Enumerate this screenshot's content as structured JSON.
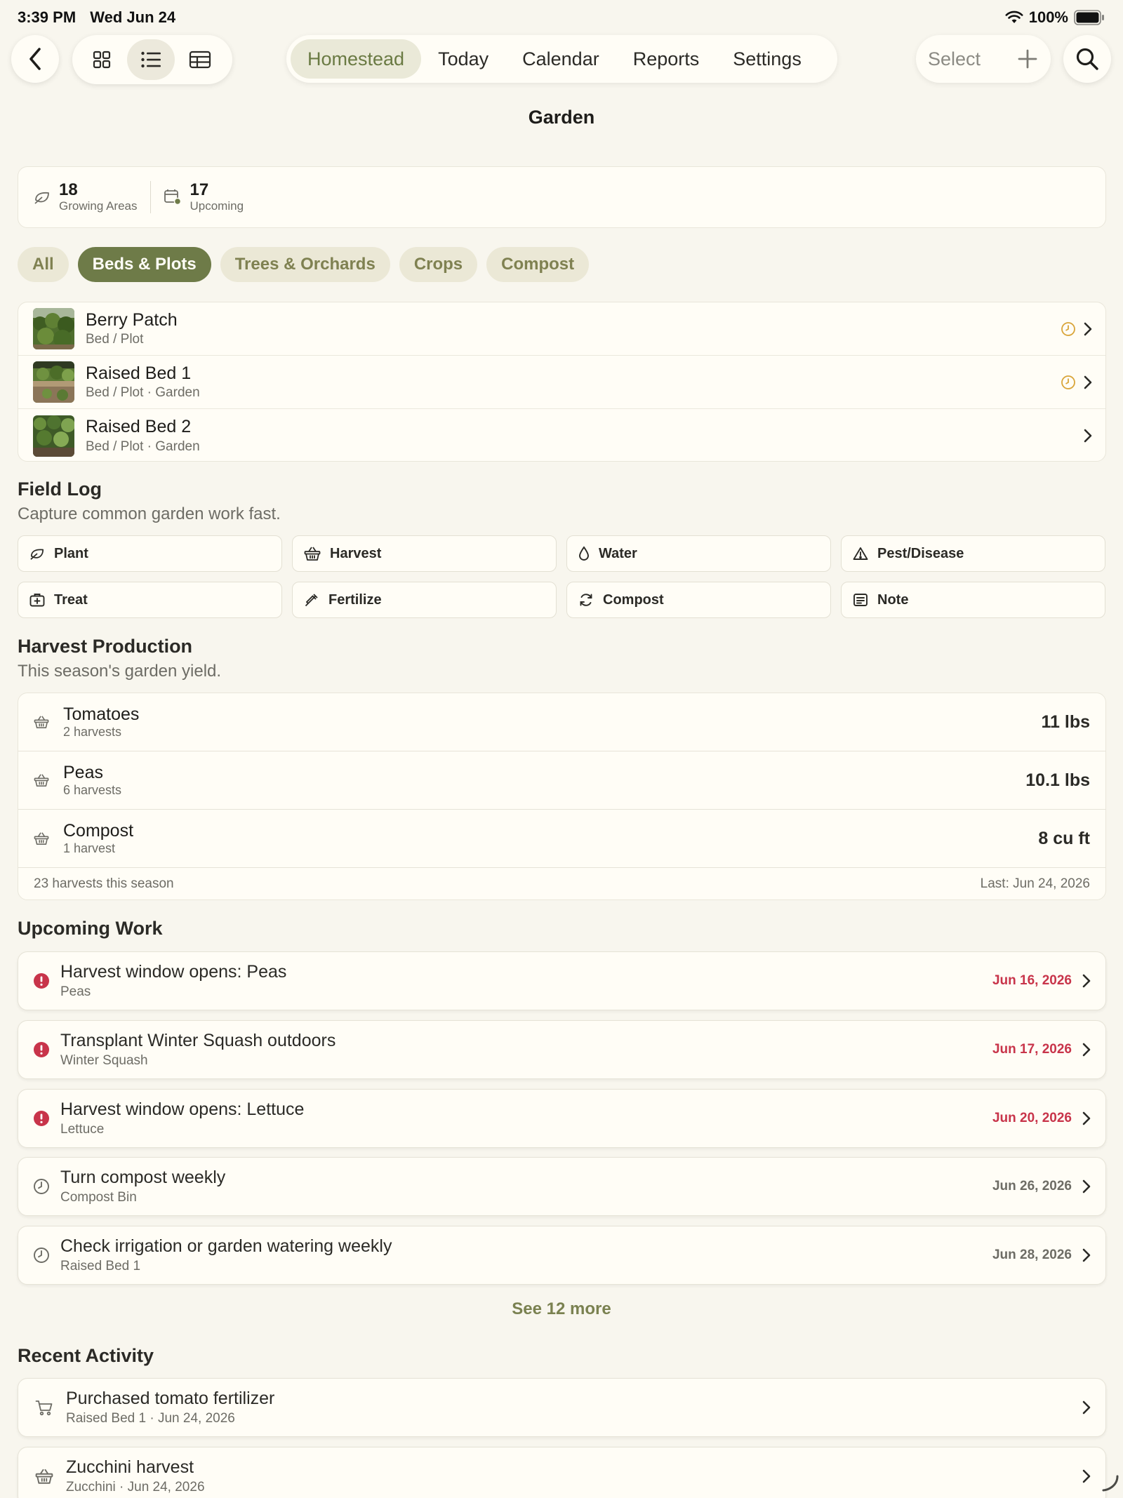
{
  "status_bar": {
    "time": "3:39 PM",
    "date": "Wed Jun 24",
    "battery": "100%"
  },
  "toolbar": {
    "nav_tabs": [
      {
        "label": "Homestead",
        "active": true
      },
      {
        "label": "Today",
        "active": false
      },
      {
        "label": "Calendar",
        "active": false
      },
      {
        "label": "Reports",
        "active": false
      },
      {
        "label": "Settings",
        "active": false
      }
    ],
    "select_label": "Select"
  },
  "page_title": "Garden",
  "stats": [
    {
      "value": "18",
      "label": "Growing Areas",
      "icon": "leaf-icon"
    },
    {
      "value": "17",
      "label": "Upcoming",
      "icon": "calendar-badge-icon"
    }
  ],
  "filters": [
    {
      "label": "All",
      "active": false
    },
    {
      "label": "Beds & Plots",
      "active": true
    },
    {
      "label": "Trees & Orchards",
      "active": false
    },
    {
      "label": "Crops",
      "active": false
    },
    {
      "label": "Compost",
      "active": false
    }
  ],
  "areas": [
    {
      "name": "Berry Patch",
      "type": "Bed / Plot",
      "has_pending": true
    },
    {
      "name": "Raised Bed 1",
      "type": "Bed / Plot · Garden",
      "has_pending": true
    },
    {
      "name": "Raised Bed 2",
      "type": "Bed / Plot · Garden",
      "has_pending": false
    }
  ],
  "field_log": {
    "title": "Field Log",
    "subtitle": "Capture common garden work fast.",
    "actions": [
      {
        "label": "Plant",
        "icon": "leaf-icon"
      },
      {
        "label": "Harvest",
        "icon": "basket-icon"
      },
      {
        "label": "Water",
        "icon": "drop-icon"
      },
      {
        "label": "Pest/Disease",
        "icon": "warning-icon"
      },
      {
        "label": "Treat",
        "icon": "medkit-icon"
      },
      {
        "label": "Fertilize",
        "icon": "dropper-icon"
      },
      {
        "label": "Compost",
        "icon": "cycle-icon"
      },
      {
        "label": "Note",
        "icon": "note-icon"
      }
    ]
  },
  "harvest": {
    "title": "Harvest Production",
    "subtitle": "This season's garden yield.",
    "items": [
      {
        "name": "Tomatoes",
        "count": "2 harvests",
        "amount": "11 lbs"
      },
      {
        "name": "Peas",
        "count": "6 harvests",
        "amount": "10.1 lbs"
      },
      {
        "name": "Compost",
        "count": "1 harvest",
        "amount": "8 cu ft"
      }
    ],
    "footer_left": "23 harvests this season",
    "footer_right": "Last: Jun 24, 2026"
  },
  "upcoming": {
    "title": "Upcoming Work",
    "tasks": [
      {
        "title": "Harvest window opens: Peas",
        "sub": "Peas",
        "date": "Jun 16, 2026",
        "overdue": true
      },
      {
        "title": "Transplant Winter Squash outdoors",
        "sub": "Winter Squash",
        "date": "Jun 17, 2026",
        "overdue": true
      },
      {
        "title": "Harvest window opens: Lettuce",
        "sub": "Lettuce",
        "date": "Jun 20, 2026",
        "overdue": true
      },
      {
        "title": "Turn compost weekly",
        "sub": "Compost Bin",
        "date": "Jun 26, 2026",
        "overdue": false
      },
      {
        "title": "Check irrigation or garden watering weekly",
        "sub": "Raised Bed 1",
        "date": "Jun 28, 2026",
        "overdue": false
      }
    ],
    "see_more": "See 12 more"
  },
  "recent": {
    "title": "Recent Activity",
    "items": [
      {
        "title": "Purchased tomato fertilizer",
        "sub": "Raised Bed 1 · Jun 24, 2026",
        "icon": "cart-icon"
      },
      {
        "title": "Zucchini harvest",
        "sub": "Zucchini · Jun 24, 2026",
        "icon": "basket-icon"
      }
    ]
  },
  "colors": {
    "background": "#f8f6ee",
    "accent": "#6e7b48",
    "overdue": "#c8344a",
    "pending": "#d9a53a"
  }
}
